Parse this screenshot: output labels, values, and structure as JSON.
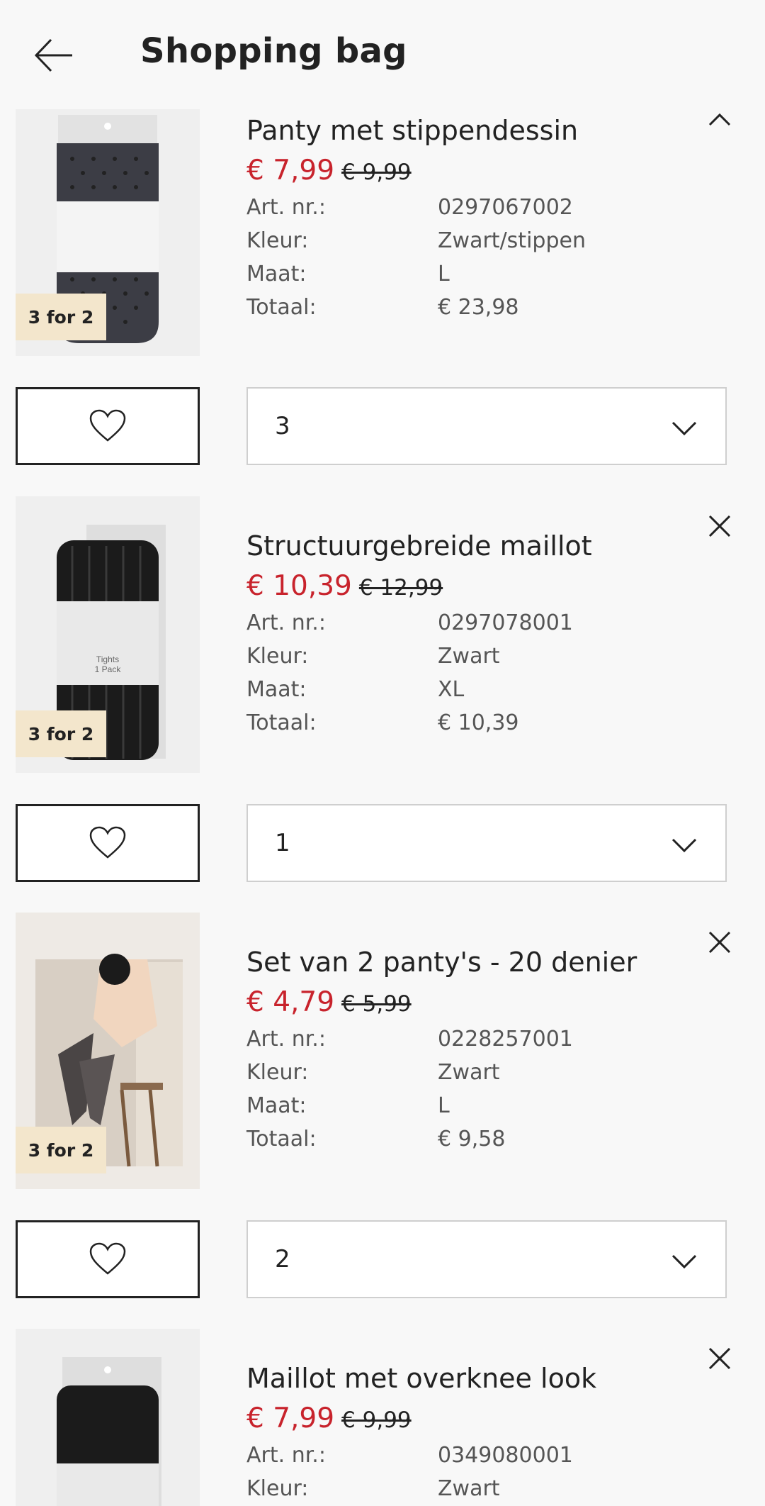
{
  "header": {
    "title": "Shopping bag",
    "back_icon": "arrow-left-icon"
  },
  "labels": {
    "art": "Art. nr.:",
    "color": "Kleur:",
    "size": "Maat:",
    "total": "Totaal:"
  },
  "products": [
    {
      "name": "Panty met stippendessin",
      "price": "€ 7,99",
      "old_price": "€ 9,99",
      "art": "0297067002",
      "color": "Zwart/stippen",
      "size": "L",
      "total": "€ 23,98",
      "badge": "3 for 2",
      "qty": "3",
      "corner_icon": "chevron-up-icon"
    },
    {
      "name": "Structuurgebreide maillot",
      "price": "€ 10,39",
      "old_price": "€ 12,99",
      "art": "0297078001",
      "color": "Zwart",
      "size": "XL",
      "total": "€ 10,39",
      "badge": "3 for 2",
      "qty": "1",
      "corner_icon": "close-icon",
      "package_text": "Tights\n1 Pack"
    },
    {
      "name": "Set van 2 panty's - 20 denier",
      "price": "€ 4,79",
      "old_price": "€ 5,99",
      "art": "0228257001",
      "color": "Zwart",
      "size": "L",
      "total": "€ 9,58",
      "badge": "3 for 2",
      "qty": "2",
      "corner_icon": "close-icon"
    },
    {
      "name": "Maillot met overknee look",
      "price": "€ 7,99",
      "old_price": "€ 9,99",
      "art": "0349080001",
      "color": "Zwart",
      "corner_icon": "close-icon"
    }
  ],
  "colors": {
    "sale": "#c8232c",
    "badge_bg": "#f3e6cc",
    "background": "#f8f8f8"
  }
}
